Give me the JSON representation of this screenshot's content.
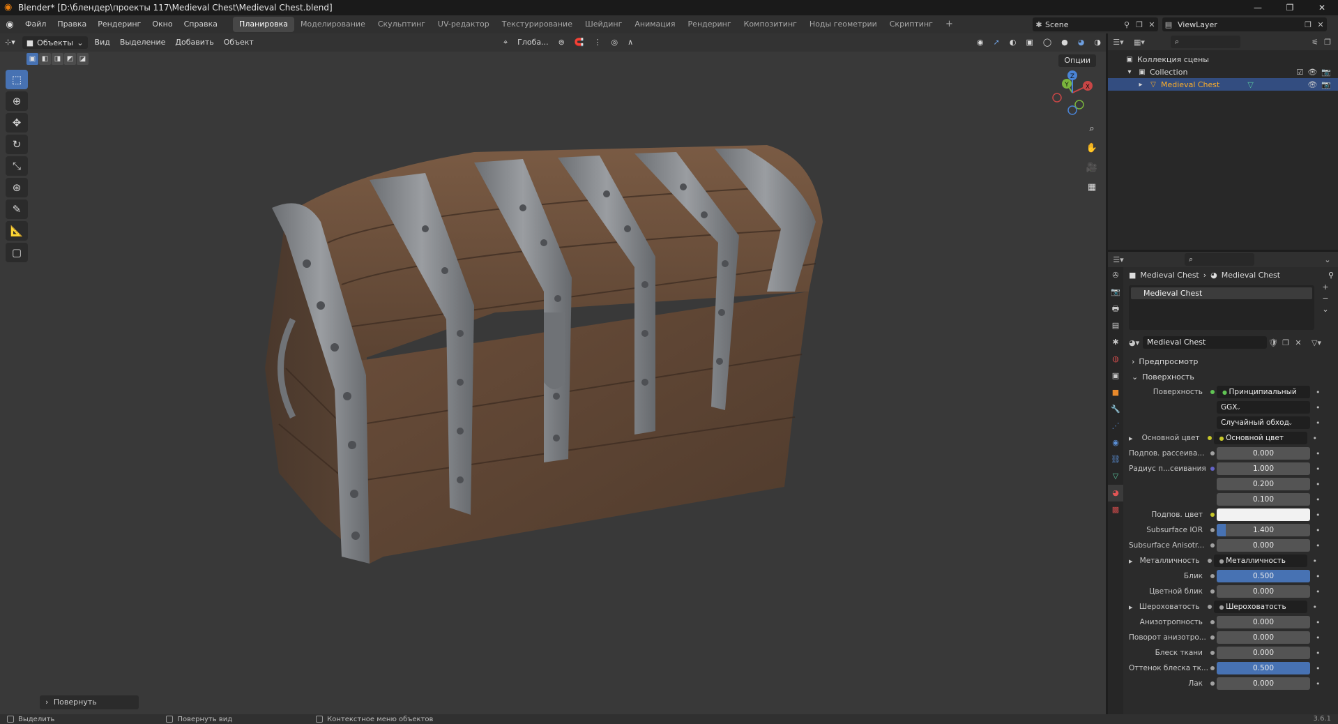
{
  "window": {
    "title": "Blender* [D:\\блендер\\проекты 117\\Medieval Chest\\Medieval Chest.blend]",
    "controls": [
      "—",
      "❐",
      "✕"
    ]
  },
  "menus": [
    "Файл",
    "Правка",
    "Рендеринг",
    "Окно",
    "Справка"
  ],
  "workspaces": [
    "Планировка",
    "Моделирование",
    "Скульптинг",
    "UV-редактор",
    "Текстурирование",
    "Шейдинг",
    "Анимация",
    "Рендеринг",
    "Композитинг",
    "Ноды геометрии",
    "Скриптинг"
  ],
  "workspace_add": "+",
  "scene": {
    "label": "Scene",
    "viewlayer": "ViewLayer"
  },
  "viewport": {
    "mode": "Объекты",
    "menu": [
      "Вид",
      "Выделение",
      "Добавить",
      "Объект"
    ],
    "orientation": "Глоба...",
    "options": "Опции",
    "last_operator": "Повернуть",
    "gizmo": {
      "x": "X",
      "y": "Y",
      "z": "Z"
    }
  },
  "outliner": {
    "root": "Коллекция сцены",
    "collection": "Collection",
    "object": "Medieval Chest"
  },
  "properties": {
    "breadcrumb": [
      "Medieval Chest",
      "Medieval Chest"
    ],
    "slot": "Medieval Chest",
    "material": "Medieval Chest",
    "panels": {
      "preview": "Предпросмотр",
      "surface": "Поверхность"
    },
    "rows": [
      {
        "label": "Поверхность",
        "value": "Принципиальный BSDF",
        "kind": "link",
        "dot": "#61c554"
      },
      {
        "label": "",
        "value": "GGX",
        "kind": "drop"
      },
      {
        "label": "",
        "value": "Случайный обход",
        "kind": "drop"
      },
      {
        "label": "Основной цвет",
        "value": "Основной цвет",
        "kind": "link",
        "dot": "#c7c729",
        "expand": true
      },
      {
        "label": "Подпов. рассеива...",
        "value": "0.000",
        "kind": "num",
        "dot": "#a1a1a1"
      },
      {
        "label": "Радиус п...сеивания",
        "value": "1.000",
        "kind": "num",
        "dot": "#6363c7"
      },
      {
        "label": "",
        "value": "0.200",
        "kind": "num"
      },
      {
        "label": "",
        "value": "0.100",
        "kind": "num"
      },
      {
        "label": "Подпов. цвет",
        "value": "",
        "kind": "color",
        "dot": "#c7c729"
      },
      {
        "label": "Subsurface IOR",
        "value": "1.400",
        "kind": "num",
        "dot": "#a1a1a1",
        "fill": 0.1
      },
      {
        "label": "Subsurface Anisotr...",
        "value": "0.000",
        "kind": "num",
        "dot": "#a1a1a1"
      },
      {
        "label": "Металличность",
        "value": "Металличность",
        "kind": "link",
        "dot": "#a1a1a1",
        "expand": true
      },
      {
        "label": "Блик",
        "value": "0.500",
        "kind": "num",
        "dot": "#a1a1a1",
        "fill": 1.0
      },
      {
        "label": "Цветной блик",
        "value": "0.000",
        "kind": "num",
        "dot": "#a1a1a1"
      },
      {
        "label": "Шероховатость",
        "value": "Шероховатость",
        "kind": "link",
        "dot": "#a1a1a1",
        "expand": true
      },
      {
        "label": "Анизотропность",
        "value": "0.000",
        "kind": "num",
        "dot": "#a1a1a1"
      },
      {
        "label": "Поворот анизотро...",
        "value": "0.000",
        "kind": "num",
        "dot": "#a1a1a1"
      },
      {
        "label": "Блеск ткани",
        "value": "0.000",
        "kind": "num",
        "dot": "#a1a1a1"
      },
      {
        "label": "Оттенок блеска тк...",
        "value": "0.500",
        "kind": "num",
        "dot": "#a1a1a1",
        "fill": 1.0
      },
      {
        "label": "Лак",
        "value": "0.000",
        "kind": "num",
        "dot": "#a1a1a1"
      }
    ]
  },
  "statusbar": {
    "items": [
      "Выделить",
      "Повернуть вид",
      "Контекстное меню объектов"
    ],
    "version": "3.6.1"
  },
  "colors": {
    "accent": "#4772b3",
    "selected_row": "#334d80",
    "object_name": "#ffaf29"
  }
}
